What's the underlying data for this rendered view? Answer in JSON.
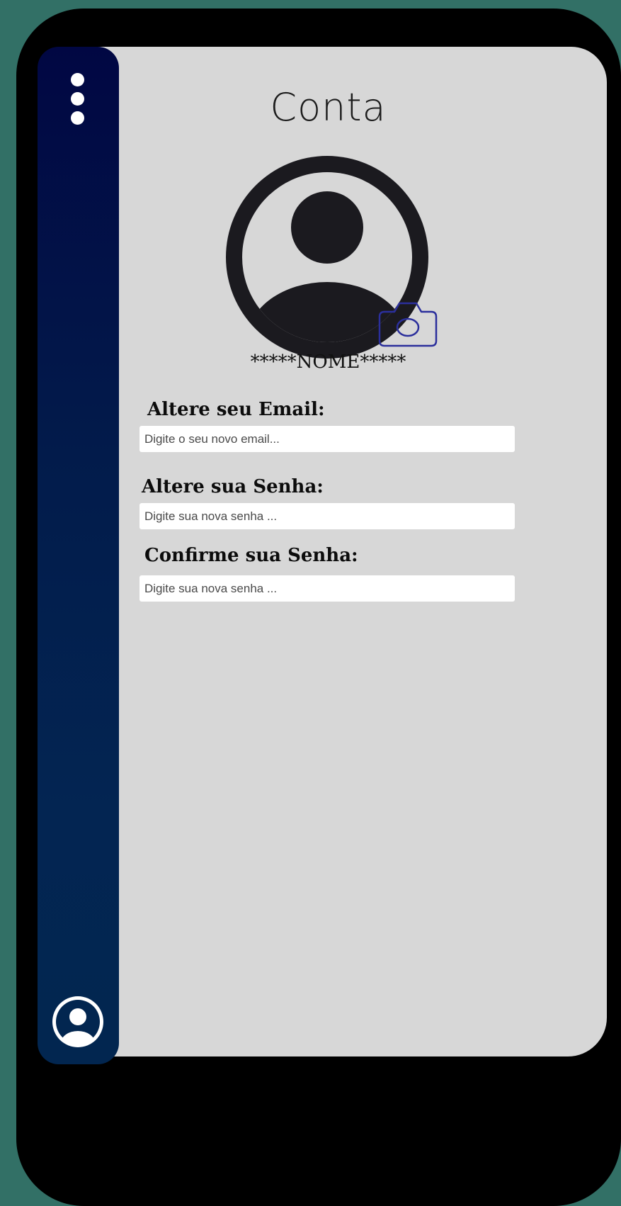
{
  "page": {
    "title": "Conta"
  },
  "profile": {
    "name": "*****NOME*****"
  },
  "form": {
    "email": {
      "label": "Altere seu Email:",
      "placeholder": "Digite o seu novo email...",
      "value": ""
    },
    "password": {
      "label": "Altere sua Senha:",
      "placeholder": "Digite sua nova senha ...",
      "value": ""
    },
    "confirm_password": {
      "label": "Confirme sua Senha:",
      "placeholder": "Digite sua nova senha ...",
      "value": ""
    }
  },
  "icons": {
    "menu": "more-vertical-icon",
    "profile_nav": "user-circle-icon",
    "avatar": "user-avatar-icon",
    "camera": "camera-icon"
  },
  "colors": {
    "background": "#327066",
    "phone_frame": "#000000",
    "screen": "#d7d7d7",
    "sidebar_top": "#010743",
    "sidebar_bottom": "#022650",
    "avatar": "#1b1a1f",
    "camera_accent": "#2b2f9c"
  }
}
